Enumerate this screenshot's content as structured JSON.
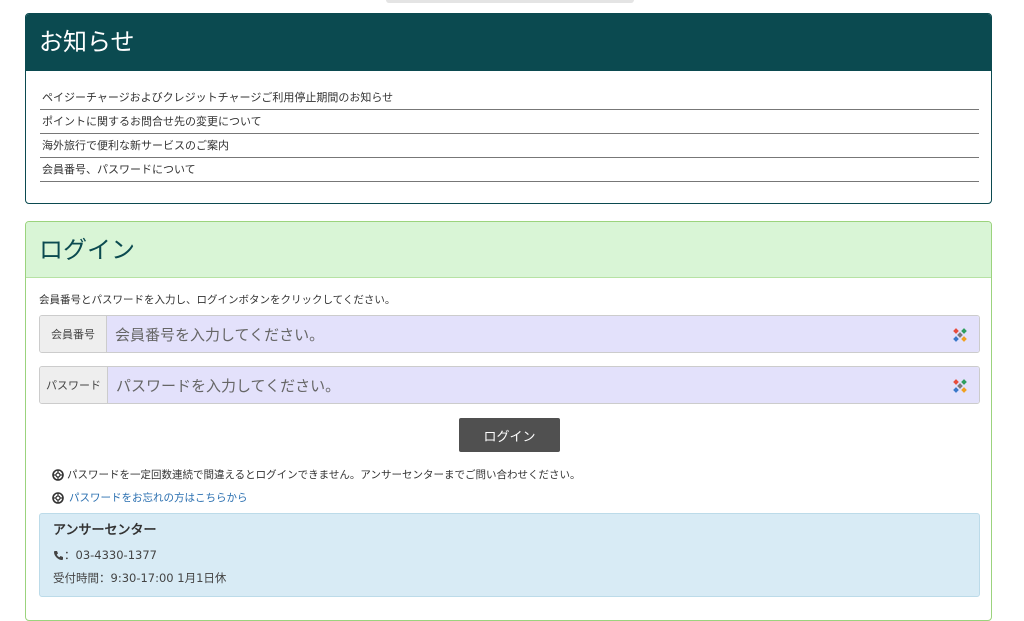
{
  "notice": {
    "title": "お知らせ",
    "items": [
      "ペイジーチャージおよびクレジットチャージご利用停止期間のお知らせ",
      "ポイントに関するお問合せ先の変更について",
      "海外旅行で便利な新サービスのご案内",
      "会員番号、パスワードについて"
    ]
  },
  "login": {
    "title": "ログイン",
    "description": "会員番号とパスワードを入力し、ログインボタンをクリックしてください。",
    "member": {
      "label": "会員番号",
      "placeholder": "会員番号を入力してください。"
    },
    "password": {
      "label": "パスワード",
      "placeholder": "パスワードを入力してください。"
    },
    "button": "ログイン",
    "warning": "パスワードを一定回数連続で間違えるとログインできません。アンサーセンターまでご問い合わせください。",
    "forgot_link": "パスワードをお忘れの方はこちらから"
  },
  "answer_center": {
    "title": "アンサーセンター",
    "phone": "：03-4330-1377",
    "hours": "受付時間：9:30-17:00 1月1日休"
  },
  "icons": {
    "lifebuoy": "lifebuoy-icon",
    "phone": "phone-icon",
    "password_manager": "password-manager-icon"
  },
  "colors": {
    "notice_header": "#0b4a50",
    "login_header": "#d9f5d6",
    "input_fill": "#e3e1fb",
    "button": "#505050",
    "link": "#2a6fb0",
    "answer_box": "#d8ebf5"
  }
}
